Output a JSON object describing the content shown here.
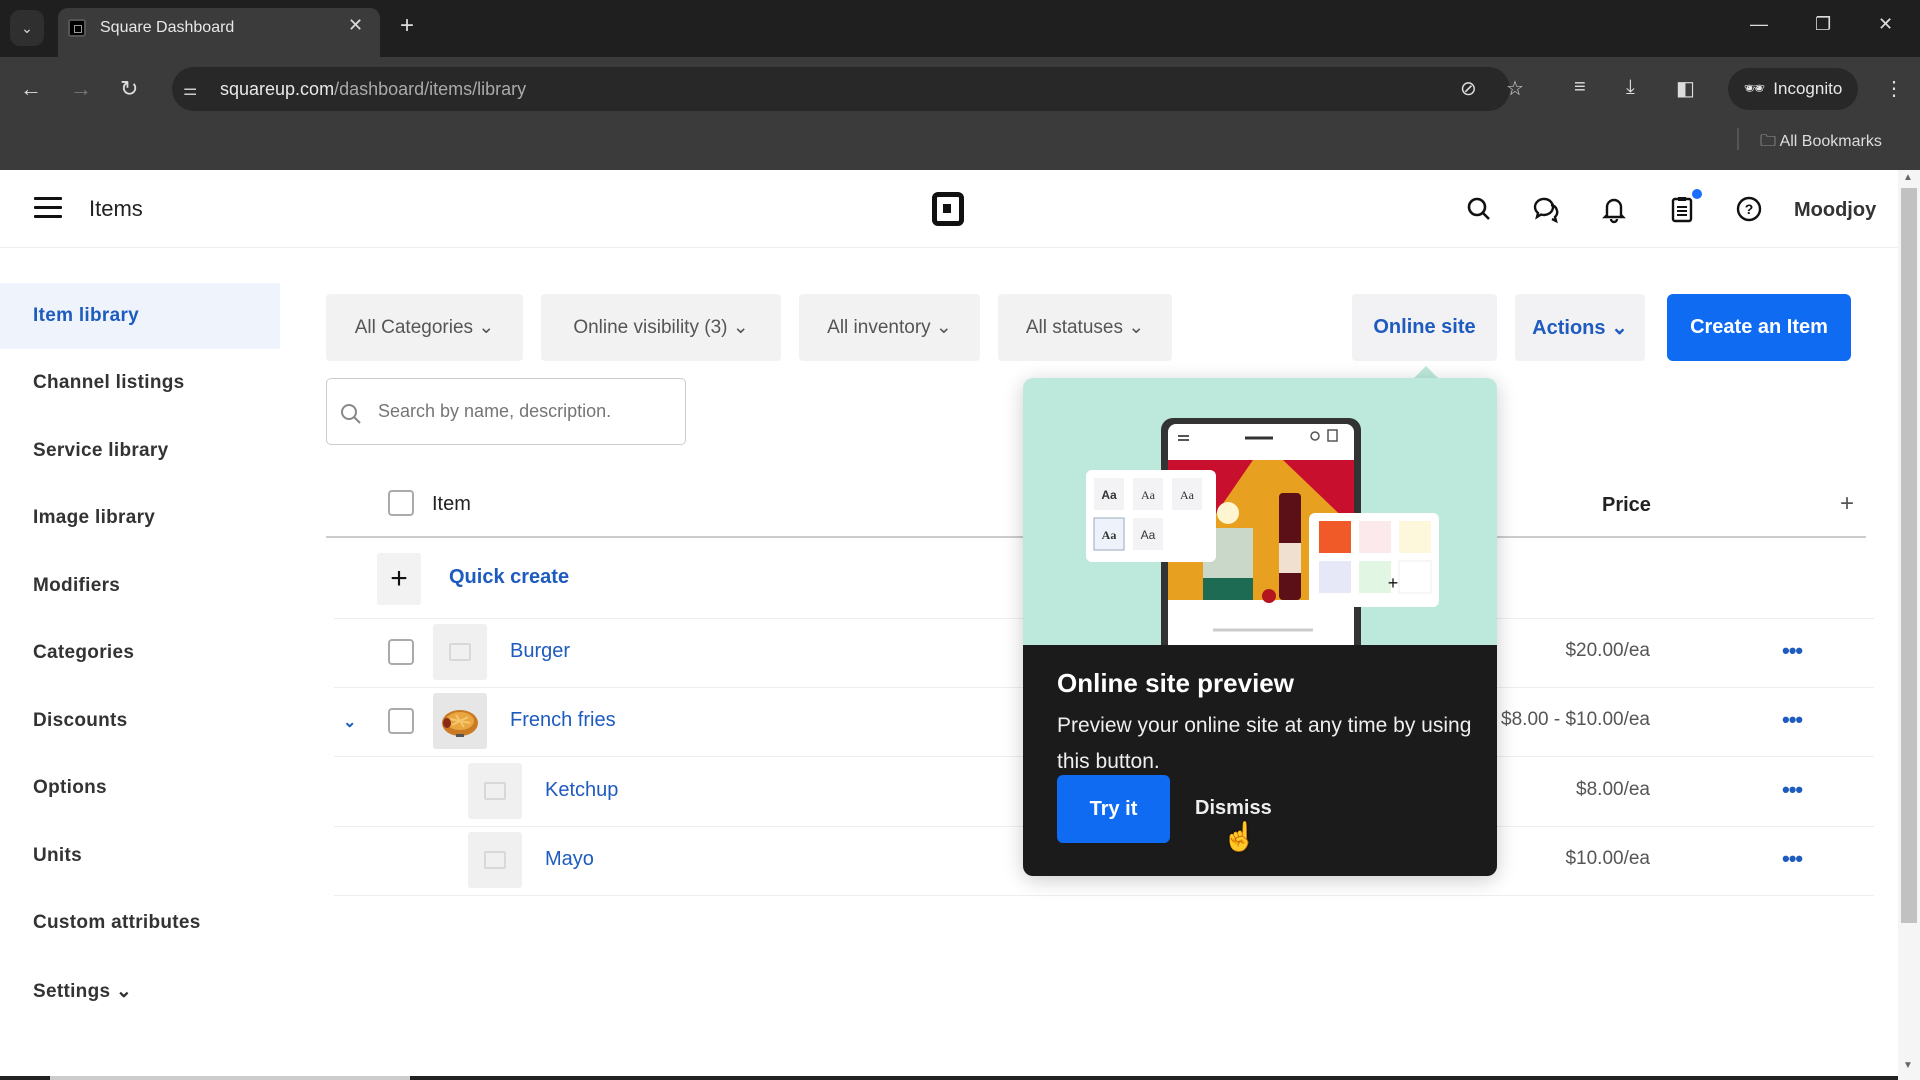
{
  "browser": {
    "tab_title": "Square Dashboard",
    "url_host": "squareup.com",
    "url_path": "/dashboard/items/library",
    "incognito_label": "Incognito",
    "bookmarks_label": "All Bookmarks"
  },
  "header": {
    "title": "Items",
    "user_name": "Moodjoy",
    "icons": [
      "search-icon",
      "messages-icon",
      "bell-icon",
      "clipboard-icon",
      "help-icon"
    ]
  },
  "sidebar": {
    "items": [
      {
        "label": "Item library",
        "active": true
      },
      {
        "label": "Channel listings"
      },
      {
        "label": "Service library"
      },
      {
        "label": "Image library"
      },
      {
        "label": "Modifiers"
      },
      {
        "label": "Categories"
      },
      {
        "label": "Discounts"
      },
      {
        "label": "Options"
      },
      {
        "label": "Units"
      },
      {
        "label": "Custom attributes"
      },
      {
        "label": "Settings ⌄"
      }
    ]
  },
  "filters": {
    "categories": "All Categories ⌄",
    "visibility": "Online visibility (3) ⌄",
    "inventory": "All inventory ⌄",
    "statuses": "All statuses ⌄"
  },
  "search": {
    "placeholder": "Search by name, description."
  },
  "actions": {
    "online_site": "Online site",
    "actions": "Actions ⌄",
    "create": "Create an Item"
  },
  "table": {
    "columns": {
      "item": "Item",
      "price": "Price"
    },
    "quick_create": "Quick create",
    "rows": [
      {
        "name": "Burger",
        "price": "$20.00/ea"
      },
      {
        "name": "French fries",
        "price": "$8.00 - $10.00/ea"
      },
      {
        "name": "Ketchup",
        "price": "$8.00/ea"
      },
      {
        "name": "Mayo",
        "price": "$10.00/ea"
      }
    ],
    "more_label": "•••"
  },
  "popover": {
    "title": "Online site preview",
    "text": "Preview your online site at any time by using this button.",
    "try_label": "Try it",
    "dismiss_label": "Dismiss",
    "font_sample": "Aa",
    "swatches": [
      "#f05a28",
      "#fbe9ec",
      "#fdf7dc",
      "#e6e8f7",
      "#e2f6e4"
    ]
  },
  "colors": {
    "accent": "#0e6bf2",
    "link": "#1e5bbf",
    "popover_bg": "#1b1b1b",
    "illus_bg": "#bce9dc"
  }
}
